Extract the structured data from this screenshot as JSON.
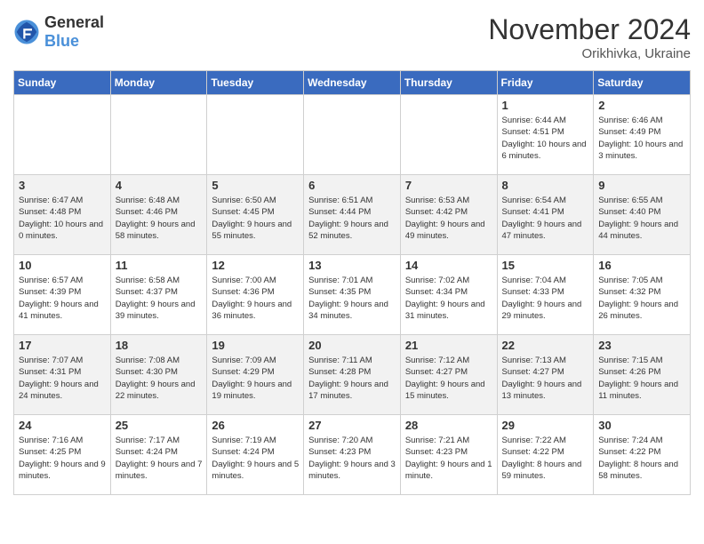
{
  "header": {
    "logo_general": "General",
    "logo_blue": "Blue",
    "month_title": "November 2024",
    "location": "Orikhivka, Ukraine"
  },
  "weekdays": [
    "Sunday",
    "Monday",
    "Tuesday",
    "Wednesday",
    "Thursday",
    "Friday",
    "Saturday"
  ],
  "weeks": [
    [
      {
        "day": "",
        "info": ""
      },
      {
        "day": "",
        "info": ""
      },
      {
        "day": "",
        "info": ""
      },
      {
        "day": "",
        "info": ""
      },
      {
        "day": "",
        "info": ""
      },
      {
        "day": "1",
        "info": "Sunrise: 6:44 AM\nSunset: 4:51 PM\nDaylight: 10 hours and 6 minutes."
      },
      {
        "day": "2",
        "info": "Sunrise: 6:46 AM\nSunset: 4:49 PM\nDaylight: 10 hours and 3 minutes."
      }
    ],
    [
      {
        "day": "3",
        "info": "Sunrise: 6:47 AM\nSunset: 4:48 PM\nDaylight: 10 hours and 0 minutes."
      },
      {
        "day": "4",
        "info": "Sunrise: 6:48 AM\nSunset: 4:46 PM\nDaylight: 9 hours and 58 minutes."
      },
      {
        "day": "5",
        "info": "Sunrise: 6:50 AM\nSunset: 4:45 PM\nDaylight: 9 hours and 55 minutes."
      },
      {
        "day": "6",
        "info": "Sunrise: 6:51 AM\nSunset: 4:44 PM\nDaylight: 9 hours and 52 minutes."
      },
      {
        "day": "7",
        "info": "Sunrise: 6:53 AM\nSunset: 4:42 PM\nDaylight: 9 hours and 49 minutes."
      },
      {
        "day": "8",
        "info": "Sunrise: 6:54 AM\nSunset: 4:41 PM\nDaylight: 9 hours and 47 minutes."
      },
      {
        "day": "9",
        "info": "Sunrise: 6:55 AM\nSunset: 4:40 PM\nDaylight: 9 hours and 44 minutes."
      }
    ],
    [
      {
        "day": "10",
        "info": "Sunrise: 6:57 AM\nSunset: 4:39 PM\nDaylight: 9 hours and 41 minutes."
      },
      {
        "day": "11",
        "info": "Sunrise: 6:58 AM\nSunset: 4:37 PM\nDaylight: 9 hours and 39 minutes."
      },
      {
        "day": "12",
        "info": "Sunrise: 7:00 AM\nSunset: 4:36 PM\nDaylight: 9 hours and 36 minutes."
      },
      {
        "day": "13",
        "info": "Sunrise: 7:01 AM\nSunset: 4:35 PM\nDaylight: 9 hours and 34 minutes."
      },
      {
        "day": "14",
        "info": "Sunrise: 7:02 AM\nSunset: 4:34 PM\nDaylight: 9 hours and 31 minutes."
      },
      {
        "day": "15",
        "info": "Sunrise: 7:04 AM\nSunset: 4:33 PM\nDaylight: 9 hours and 29 minutes."
      },
      {
        "day": "16",
        "info": "Sunrise: 7:05 AM\nSunset: 4:32 PM\nDaylight: 9 hours and 26 minutes."
      }
    ],
    [
      {
        "day": "17",
        "info": "Sunrise: 7:07 AM\nSunset: 4:31 PM\nDaylight: 9 hours and 24 minutes."
      },
      {
        "day": "18",
        "info": "Sunrise: 7:08 AM\nSunset: 4:30 PM\nDaylight: 9 hours and 22 minutes."
      },
      {
        "day": "19",
        "info": "Sunrise: 7:09 AM\nSunset: 4:29 PM\nDaylight: 9 hours and 19 minutes."
      },
      {
        "day": "20",
        "info": "Sunrise: 7:11 AM\nSunset: 4:28 PM\nDaylight: 9 hours and 17 minutes."
      },
      {
        "day": "21",
        "info": "Sunrise: 7:12 AM\nSunset: 4:27 PM\nDaylight: 9 hours and 15 minutes."
      },
      {
        "day": "22",
        "info": "Sunrise: 7:13 AM\nSunset: 4:27 PM\nDaylight: 9 hours and 13 minutes."
      },
      {
        "day": "23",
        "info": "Sunrise: 7:15 AM\nSunset: 4:26 PM\nDaylight: 9 hours and 11 minutes."
      }
    ],
    [
      {
        "day": "24",
        "info": "Sunrise: 7:16 AM\nSunset: 4:25 PM\nDaylight: 9 hours and 9 minutes."
      },
      {
        "day": "25",
        "info": "Sunrise: 7:17 AM\nSunset: 4:24 PM\nDaylight: 9 hours and 7 minutes."
      },
      {
        "day": "26",
        "info": "Sunrise: 7:19 AM\nSunset: 4:24 PM\nDaylight: 9 hours and 5 minutes."
      },
      {
        "day": "27",
        "info": "Sunrise: 7:20 AM\nSunset: 4:23 PM\nDaylight: 9 hours and 3 minutes."
      },
      {
        "day": "28",
        "info": "Sunrise: 7:21 AM\nSunset: 4:23 PM\nDaylight: 9 hours and 1 minute."
      },
      {
        "day": "29",
        "info": "Sunrise: 7:22 AM\nSunset: 4:22 PM\nDaylight: 8 hours and 59 minutes."
      },
      {
        "day": "30",
        "info": "Sunrise: 7:24 AM\nSunset: 4:22 PM\nDaylight: 8 hours and 58 minutes."
      }
    ]
  ]
}
